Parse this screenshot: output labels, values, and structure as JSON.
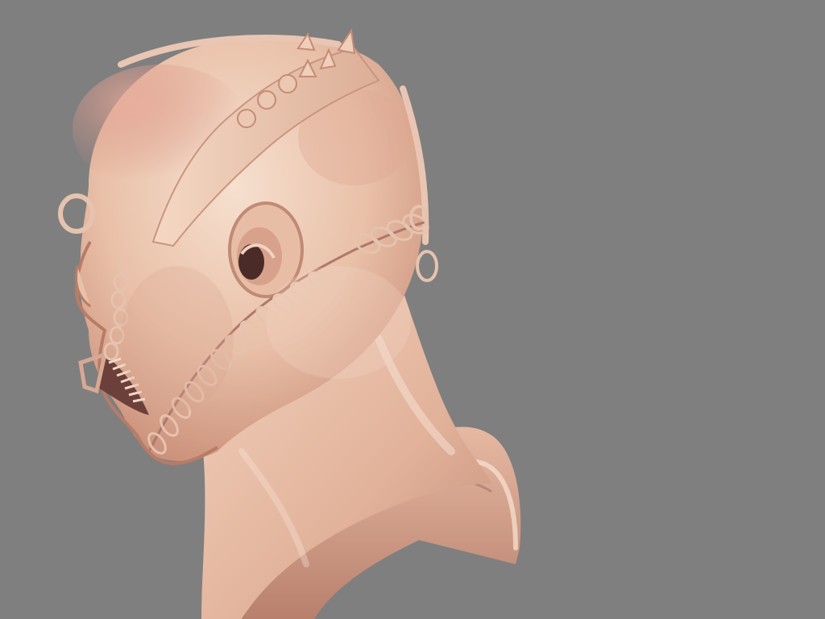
{
  "scene": {
    "subject": "sculpted-creature-head-bust",
    "view": "side-profile-left",
    "colors": {
      "background": "#7f7f7f",
      "skin_light": "#f3d9c6",
      "skin_mid": "#e3b49b",
      "skin_dark": "#b9826e",
      "skin_shadow": "#8d5a4f",
      "flesh_pink": "#d89a8c"
    }
  }
}
